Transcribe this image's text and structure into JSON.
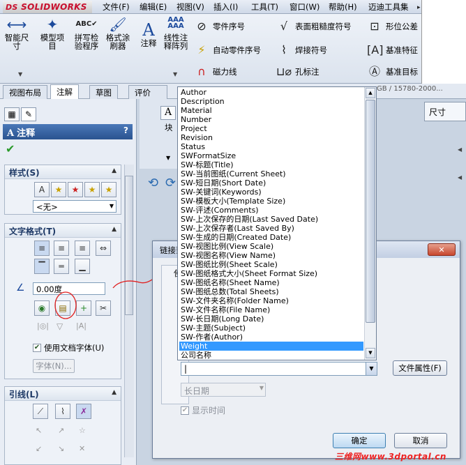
{
  "app": {
    "logo_prefix": "DS",
    "logo_text": "SOLIDWORKS"
  },
  "menu": [
    "文件(F)",
    "编辑(E)",
    "视图(V)",
    "插入(I)",
    "工具(T)",
    "窗口(W)",
    "帮助(H)",
    "迈迪工具集"
  ],
  "ribbon": {
    "smart_dim": "智能尺寸",
    "model_items": "模型项目",
    "spell": "拼写检验程序",
    "format_painter": "格式涂刷器",
    "note": "注释",
    "linear_pattern": "线性注释阵列",
    "balloon": "零件序号",
    "auto_balloon": "自动零件序号",
    "magnetic_line": "磁力线",
    "surface_finish": "表面粗糙度符号",
    "weld_symbol": "焊接符号",
    "hole_callout": "孔标注",
    "gtol": "形位公差",
    "datum_feature": "基准特征",
    "datum_target": "基准目标",
    "icon_abc": "ABC"
  },
  "tabs": [
    "视图布局",
    "注解",
    "草图",
    "评价"
  ],
  "standard_text": "GB / 15780-2000...",
  "size_box": "尺寸",
  "panel": {
    "title": "注释",
    "help": "?",
    "style_header": "样式(S)",
    "style_value": "<无>",
    "text_format_header": "文字格式(T)",
    "angle_value": "0.00度",
    "use_doc_font": "使用文档字体(U)",
    "font_button": "字体(N)...",
    "leader_header": "引线(L)"
  },
  "dialog": {
    "title": "链接到",
    "inner_label": "使",
    "combo_value": "|",
    "file_props": "文件属性(F)",
    "date_format": "长日期",
    "show_time": "显示时间",
    "ok": "确定",
    "cancel": "取消",
    "close": "✕"
  },
  "dropdown": {
    "items": [
      "Author",
      "Description",
      "Material",
      "Number",
      "Project",
      "Revision",
      "Status",
      "SWFormatSize",
      "SW-标题(Title)",
      "SW-当前图纸(Current Sheet)",
      "SW-短日期(Short Date)",
      "SW-关键词(Keywords)",
      "SW-模板大小(Template Size)",
      "SW-评述(Comments)",
      "SW-上次保存的日期(Last Saved Date)",
      "SW-上次保存者(Last Saved By)",
      "SW-生成的日期(Created Date)",
      "SW-视图比例(View Scale)",
      "SW-视图名称(View Name)",
      "SW-图纸比例(Sheet Scale)",
      "SW-图纸格式大小(Sheet Format Size)",
      "SW-图纸名称(Sheet Name)",
      "SW-图纸总数(Total Sheets)",
      "SW-文件夹名称(Folder Name)",
      "SW-文件名称(File Name)",
      "SW-长日期(Long Date)",
      "SW-主题(Subject)",
      "SW-作者(Author)",
      "Weight",
      "公司名称"
    ],
    "selected_index": 28
  },
  "block_label": "块",
  "watermark": "三维网www.3dportal.cn",
  "colors": {
    "selection": "#3399ff",
    "panel_header": "#2a5390",
    "watermark": "#e22222"
  }
}
